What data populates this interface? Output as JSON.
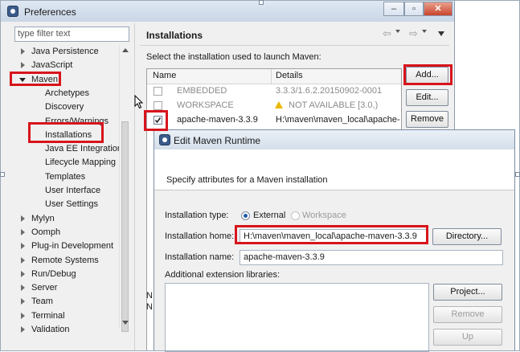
{
  "pref": {
    "title": "Preferences",
    "filter_placeholder": "type filter text",
    "tree": [
      {
        "label": "Java Persistence",
        "state": "collapsed",
        "level": 0
      },
      {
        "label": "JavaScript",
        "state": "collapsed",
        "level": 0
      },
      {
        "label": "Maven",
        "state": "expanded",
        "level": 0
      },
      {
        "label": "Archetypes",
        "level": 1
      },
      {
        "label": "Discovery",
        "level": 1
      },
      {
        "label": "Errors/Warnings",
        "level": 1
      },
      {
        "label": "Installations",
        "level": 1,
        "selected": true
      },
      {
        "label": "Java EE Integration",
        "level": 1
      },
      {
        "label": "Lifecycle Mapping",
        "level": 1
      },
      {
        "label": "Templates",
        "level": 1
      },
      {
        "label": "User Interface",
        "level": 1
      },
      {
        "label": "User Settings",
        "level": 1
      },
      {
        "label": "Mylyn",
        "state": "collapsed",
        "level": 0
      },
      {
        "label": "Oomph",
        "state": "collapsed",
        "level": 0
      },
      {
        "label": "Plug-in Development",
        "state": "collapsed",
        "level": 0
      },
      {
        "label": "Remote Systems",
        "state": "collapsed",
        "level": 0
      },
      {
        "label": "Run/Debug",
        "state": "collapsed",
        "level": 0
      },
      {
        "label": "Server",
        "state": "collapsed",
        "level": 0
      },
      {
        "label": "Team",
        "state": "collapsed",
        "level": 0
      },
      {
        "label": "Terminal",
        "state": "collapsed",
        "level": 0
      },
      {
        "label": "Validation",
        "state": "collapsed",
        "level": 0
      }
    ],
    "pane_title": "Installations",
    "pane_nav": {
      "back": "⇦",
      "forward": "⇨",
      "menu": "▾"
    },
    "description": "Select the installation used to launch Maven:",
    "columns": {
      "name": "Name",
      "details": "Details"
    },
    "rows": [
      {
        "name": "EMBEDDED",
        "details": "3.3.3/1.6.2.20150902-0001",
        "checked": false,
        "muted": true,
        "warn": false
      },
      {
        "name": "WORKSPACE",
        "details": "NOT AVAILABLE [3.0,)",
        "checked": false,
        "muted": true,
        "warn": true
      },
      {
        "name": "apache-maven-3.3.9",
        "details": "H:\\maven\\maven_local\\apache-",
        "checked": true,
        "muted": false,
        "warn": false
      }
    ],
    "buttons": {
      "add": "Add...",
      "edit": "Edit...",
      "remove": "Remove"
    },
    "partial_left_text": "N\nN"
  },
  "dialog": {
    "title": "Edit Maven Runtime",
    "subtitle": "Specify attributes for a Maven installation",
    "type_label": "Installation type:",
    "type_options": [
      {
        "label": "External",
        "selected": true
      },
      {
        "label": "Workspace",
        "selected": false
      }
    ],
    "home_label": "Installation home:",
    "home_value": "H:\\maven\\maven_local\\apache-maven-3.3.9",
    "directory_button": "Directory...",
    "name_label": "Installation name:",
    "name_value": "apache-maven-3.3.9",
    "libs_label": "Additional extension libraries:",
    "lib_buttons": {
      "project": "Project...",
      "remove": "Remove",
      "up": "Up"
    }
  },
  "colors": {
    "highlight": "#d8141c",
    "accent": "#1f5aa8"
  }
}
